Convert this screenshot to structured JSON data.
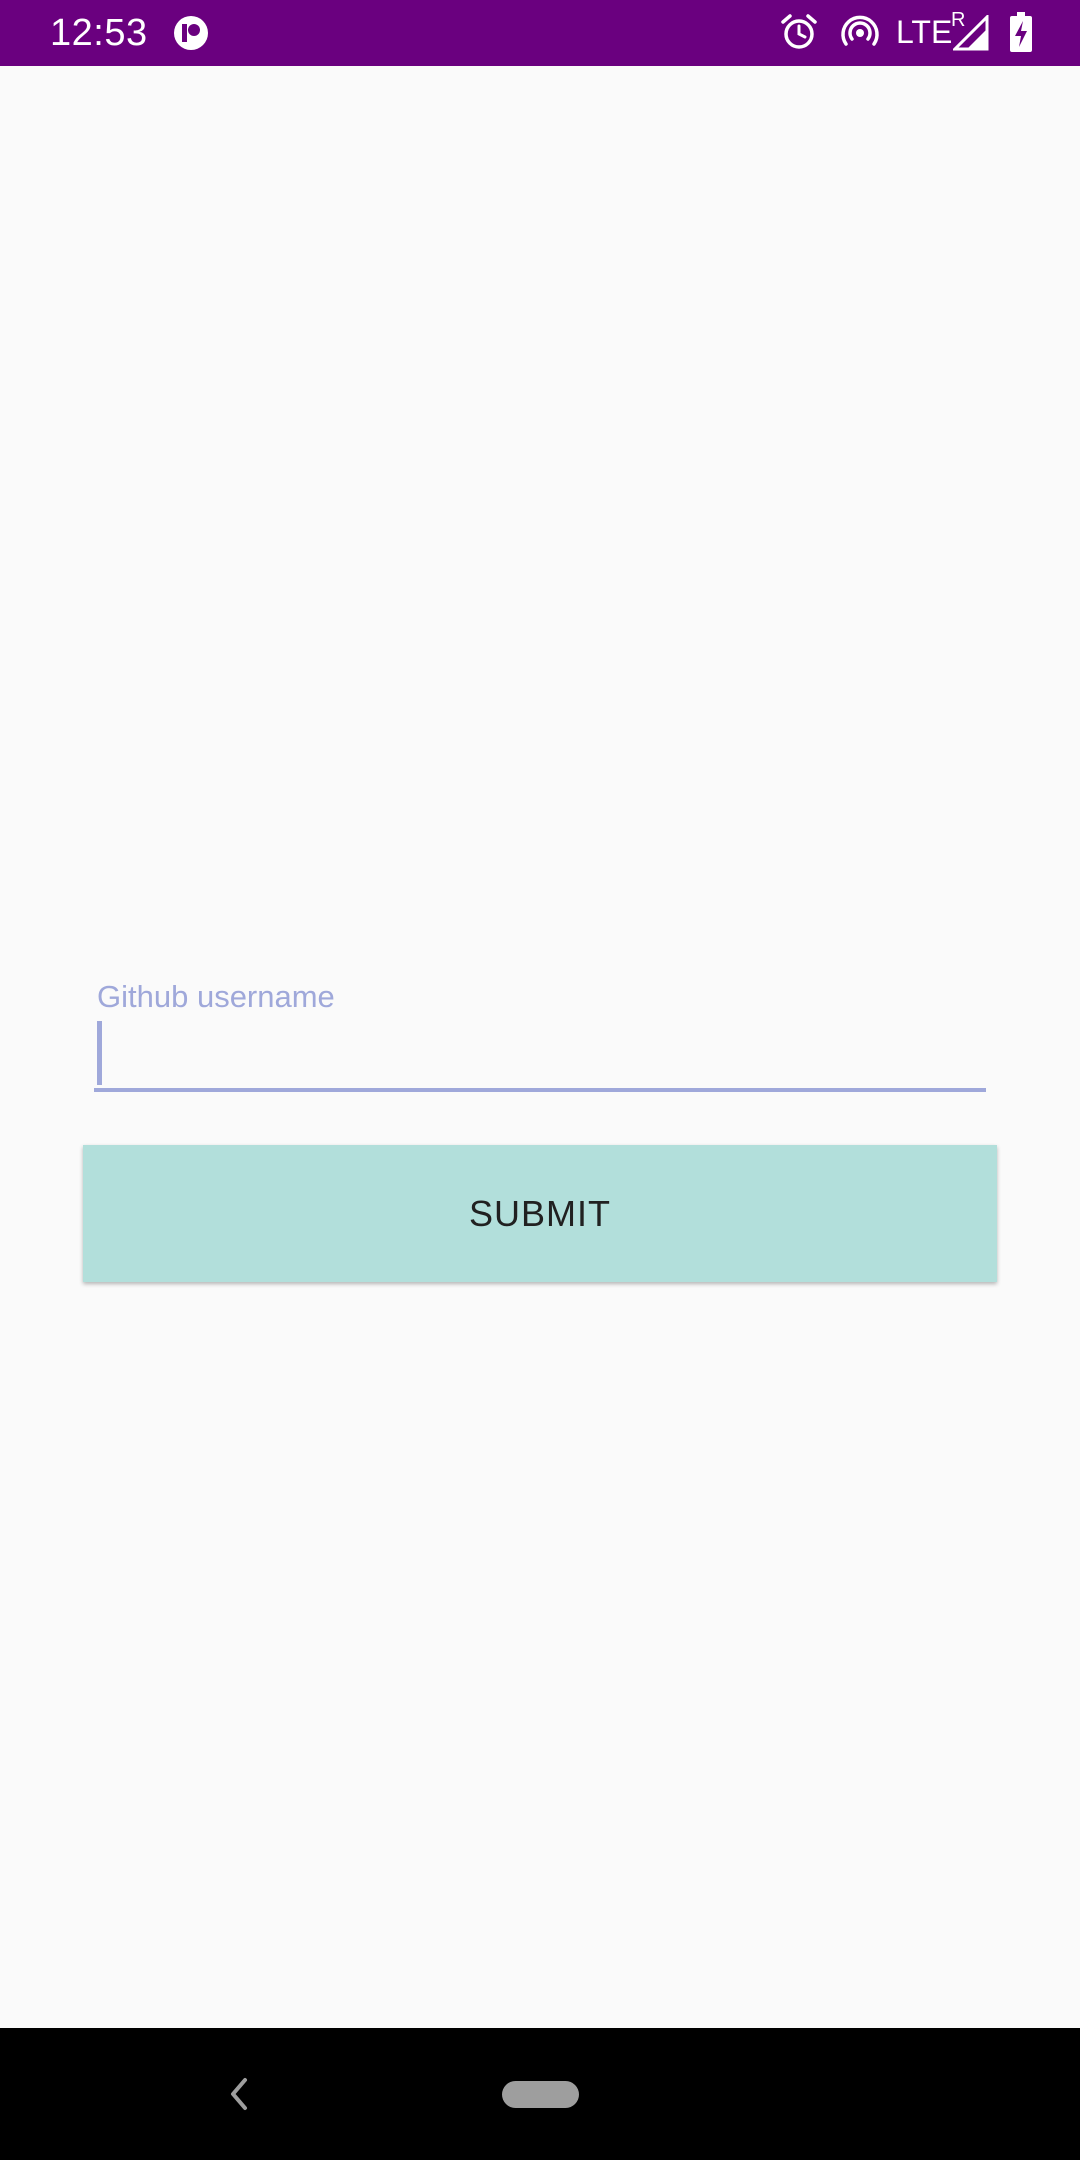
{
  "status_bar": {
    "time": "12:53",
    "network_type": "LTE",
    "roaming_indicator": "R",
    "background_color": "#6A007F",
    "icons": [
      "app-notification-icon",
      "alarm-icon",
      "hotspot-icon",
      "signal-icon",
      "battery-charging-icon"
    ]
  },
  "form": {
    "username_label": "Github username",
    "username_value": "",
    "submit_label": "SUBMIT",
    "accent_color": "#9FA8DA",
    "button_color": "#B2DFDB"
  },
  "nav_bar": {
    "icons": [
      "back-icon",
      "home-pill-icon"
    ]
  }
}
